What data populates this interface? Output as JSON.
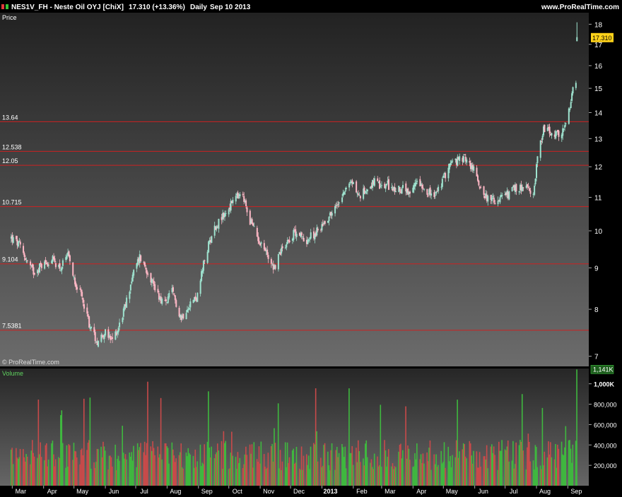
{
  "header": {
    "title": "NES1V_FH - Neste Oil OYJ [ChiX]",
    "last": "17.310 (+13.36%)",
    "period": "Daily",
    "date": "Sep 10 2013",
    "site": "www.ProRealTime.com"
  },
  "price_panel": {
    "label": "Price",
    "watermark": "© ProRealTime.com",
    "last_price_tag": "17.310"
  },
  "volume_panel": {
    "label": "Volume",
    "last_volume_tag": "1,141K"
  },
  "colors": {
    "up": "#9ee3cf",
    "down": "#ffb8c6",
    "vol_up": "#3fb83f",
    "vol_down": "#c84a4a",
    "level_line": "#cc2222",
    "tag_bg": "#ffd21a"
  },
  "chart_data": [
    {
      "type": "candlestick",
      "scale": "log",
      "ylim": [
        6.8,
        18.6
      ],
      "y_ticks": [
        "7",
        "8",
        "9",
        "10",
        "11",
        "12",
        "13",
        "14",
        "15",
        "16",
        "17",
        "18"
      ],
      "x_ticks": [
        "Mar",
        "Apr",
        "May",
        "Jun",
        "Jul",
        "Aug",
        "Sep",
        "Oct",
        "Nov",
        "Dec",
        "2013",
        "Feb",
        "Mar",
        "Apr",
        "May",
        "Jun",
        "Jul",
        "Aug",
        "Sep"
      ],
      "horizontal_levels": [
        "13.64",
        "12.538",
        "12.05",
        "10.715",
        "9.104",
        "7.5381"
      ],
      "last_price": 17.31,
      "close_path": [
        [
          "2012-02-29",
          9.8
        ],
        [
          "2012-03-08",
          9.6
        ],
        [
          "2012-03-15",
          9.2
        ],
        [
          "2012-03-22",
          8.9
        ],
        [
          "2012-03-31",
          9.1
        ],
        [
          "2012-04-10",
          9.2
        ],
        [
          "2012-04-18",
          9.0
        ],
        [
          "2012-04-25",
          9.3
        ],
        [
          "2012-05-03",
          8.6
        ],
        [
          "2012-05-10",
          8.2
        ],
        [
          "2012-05-17",
          7.6
        ],
        [
          "2012-05-24",
          7.3
        ],
        [
          "2012-05-31",
          7.5
        ],
        [
          "2012-06-07",
          7.3
        ],
        [
          "2012-06-14",
          7.6
        ],
        [
          "2012-06-21",
          8.1
        ],
        [
          "2012-06-28",
          8.8
        ],
        [
          "2012-07-05",
          9.3
        ],
        [
          "2012-07-15",
          8.8
        ],
        [
          "2012-07-22",
          8.4
        ],
        [
          "2012-07-29",
          8.1
        ],
        [
          "2012-08-06",
          8.4
        ],
        [
          "2012-08-15",
          7.8
        ],
        [
          "2012-08-22",
          8.1
        ],
        [
          "2012-08-31",
          8.3
        ],
        [
          "2012-09-07",
          9.2
        ],
        [
          "2012-09-15",
          10.0
        ],
        [
          "2012-09-22",
          10.3
        ],
        [
          "2012-09-30",
          10.6
        ],
        [
          "2012-10-07",
          11.0
        ],
        [
          "2012-10-15",
          11.0
        ],
        [
          "2012-10-22",
          10.3
        ],
        [
          "2012-10-30",
          9.8
        ],
        [
          "2012-11-07",
          9.4
        ],
        [
          "2012-11-15",
          9.0
        ],
        [
          "2012-11-22",
          9.5
        ],
        [
          "2012-11-30",
          9.8
        ],
        [
          "2012-12-07",
          10.0
        ],
        [
          "2012-12-15",
          9.7
        ],
        [
          "2012-12-28",
          10.0
        ],
        [
          "2013-01-07",
          10.4
        ],
        [
          "2013-01-15",
          10.7
        ],
        [
          "2013-01-22",
          11.2
        ],
        [
          "2013-01-31",
          11.5
        ],
        [
          "2013-02-07",
          11.0
        ],
        [
          "2013-02-15",
          11.3
        ],
        [
          "2013-02-22",
          11.5
        ],
        [
          "2013-02-28",
          11.3
        ],
        [
          "2013-03-07",
          11.4
        ],
        [
          "2013-03-15",
          11.2
        ],
        [
          "2013-03-22",
          11.3
        ],
        [
          "2013-03-29",
          11.0
        ],
        [
          "2013-04-05",
          11.6
        ],
        [
          "2013-04-15",
          11.2
        ],
        [
          "2013-04-22",
          11.0
        ],
        [
          "2013-04-30",
          11.5
        ],
        [
          "2013-05-07",
          12.1
        ],
        [
          "2013-05-15",
          12.2
        ],
        [
          "2013-05-22",
          12.3
        ],
        [
          "2013-05-31",
          11.9
        ],
        [
          "2013-06-07",
          11.3
        ],
        [
          "2013-06-15",
          10.9
        ],
        [
          "2013-06-22",
          10.9
        ],
        [
          "2013-06-30",
          11.0
        ],
        [
          "2013-07-07",
          11.2
        ],
        [
          "2013-07-15",
          11.3
        ],
        [
          "2013-07-22",
          11.3
        ],
        [
          "2013-07-29",
          11.0
        ],
        [
          "2013-08-01",
          12.1
        ],
        [
          "2013-08-08",
          13.4
        ],
        [
          "2013-08-15",
          13.2
        ],
        [
          "2013-08-22",
          13.1
        ],
        [
          "2013-08-29",
          13.4
        ],
        [
          "2013-09-03",
          14.2
        ],
        [
          "2013-09-07",
          15.1
        ],
        [
          "2013-09-09",
          15.3
        ]
      ]
    },
    {
      "type": "bar",
      "title": "Volume",
      "ylim": [
        0,
        1150000
      ],
      "y_ticks": [
        "200,000",
        "400,000",
        "600,000",
        "800,000",
        "1,000K"
      ],
      "last_volume": 1141000
    }
  ]
}
